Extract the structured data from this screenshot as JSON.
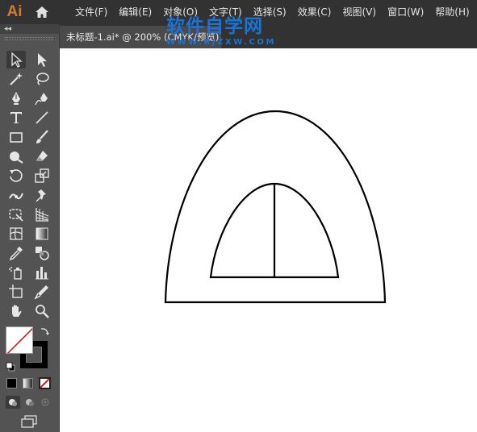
{
  "app": {
    "logo": "Ai"
  },
  "menu": {
    "items": [
      "文件(F)",
      "编辑(E)",
      "对象(O)",
      "文字(T)",
      "选择(S)",
      "效果(C)",
      "视图(V)",
      "窗口(W)",
      "帮助(H)"
    ]
  },
  "tab": {
    "title": "未标题-1.ai* @ 200% (CMYK/预览)",
    "close": "×"
  },
  "watermark": {
    "title": "软件自学网",
    "url": "WWW.RJZXW.COM"
  },
  "toolbar": {
    "collapse": "◂◂"
  },
  "colors": {
    "menubar": "#323232",
    "panel": "#535353",
    "canvas": "#ffffff",
    "stroke": "#000000",
    "none_slash": "#e0141e"
  }
}
